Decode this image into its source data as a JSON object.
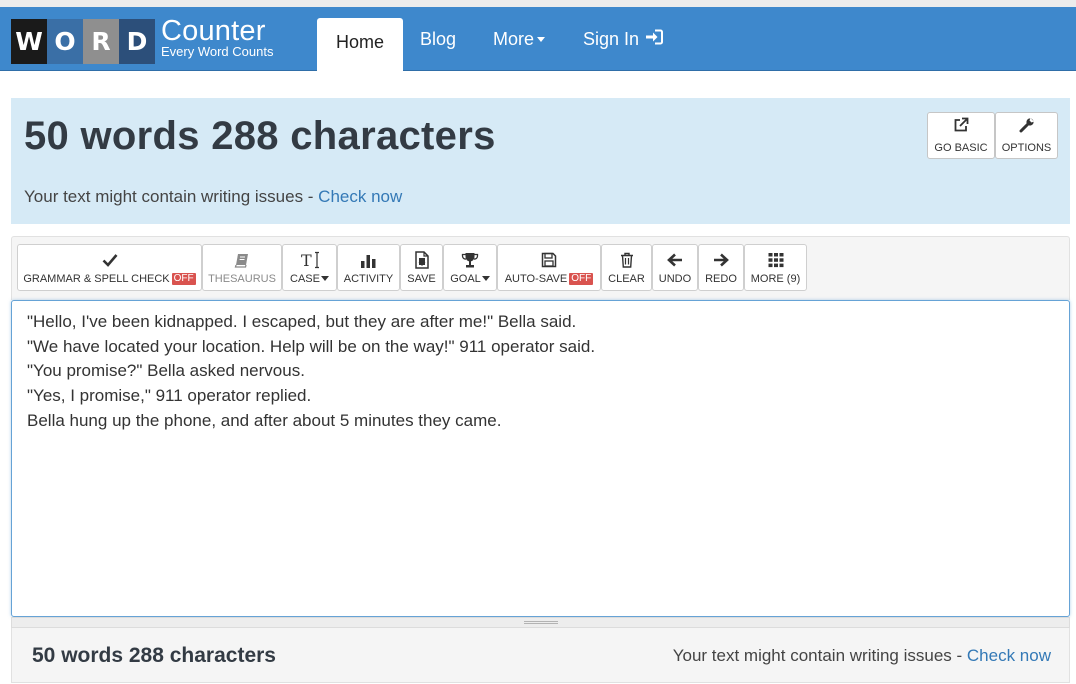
{
  "logo": {
    "letters": [
      "W",
      "O",
      "R",
      "D"
    ],
    "name": "Counter",
    "tagline": "Every Word Counts"
  },
  "nav": {
    "home": "Home",
    "blog": "Blog",
    "more": "More",
    "signin": "Sign In"
  },
  "summary": {
    "title": "50 words 288 characters",
    "issue_text": "Your text might contain writing issues - ",
    "issue_link": "Check now"
  },
  "header_buttons": {
    "go_basic": "GO BASIC",
    "options": "OPTIONS"
  },
  "toolbar": {
    "grammar": "GRAMMAR & SPELL CHECK",
    "grammar_state": "OFF",
    "thesaurus": "THESAURUS",
    "case": "CASE",
    "activity": "ACTIVITY",
    "save": "SAVE",
    "goal": "GOAL",
    "autosave": "AUTO-SAVE",
    "autosave_state": "OFF",
    "clear": "CLEAR",
    "undo": "UNDO",
    "redo": "REDO",
    "more": "MORE (9)"
  },
  "editor": {
    "lines": [
      "\"Hello, I've been kidnapped. I escaped, but they are after me!\" Bella said.",
      "\"We have located your location. Help will be on the way!\" 911 operator said.",
      "\"You promise?\" Bella asked nervous.",
      "\"Yes, I promise,\" 911 operator replied.",
      "Bella hung up the phone, and after about 5 minutes they came."
    ]
  },
  "footer": {
    "count": "50 words 288 characters",
    "issue_text": "Your text might contain writing issues - ",
    "issue_link": "Check now"
  },
  "colors": {
    "navbar": "#3e88cc",
    "hero_bg": "#d6eaf6",
    "link": "#3479b6",
    "off_badge": "#d9534f"
  }
}
